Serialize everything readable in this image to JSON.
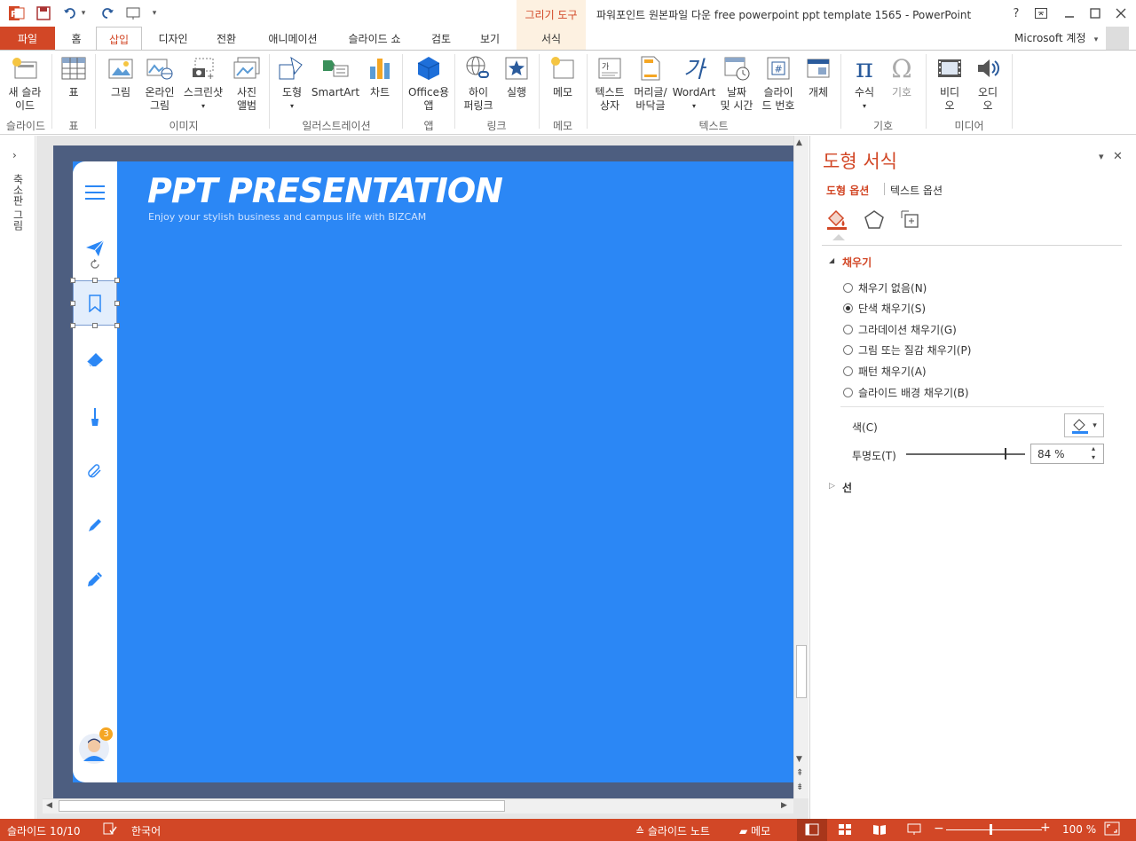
{
  "titlebar": {
    "app_title": "파워포인트 원본파일 다운 free powerpoint ppt template 1565 - PowerPoint",
    "context_group": "그리기 도구",
    "help": "?",
    "undo_dropdown": "▾",
    "qat_more": "▾"
  },
  "tabs": {
    "file": "파일",
    "items": [
      "홈",
      "삽입",
      "디자인",
      "전환",
      "애니메이션",
      "슬라이드 쇼",
      "검토",
      "보기",
      "서식"
    ],
    "active": "삽입",
    "account": "Microsoft 계정"
  },
  "ribbon": {
    "buttons": {
      "new_slide": "새 슬라\n이드",
      "table": "표",
      "picture": "그림",
      "online_picture": "온라인\n그림",
      "screenshot": "스크린샷",
      "photo_album": "사진\n앨범",
      "shapes": "도형",
      "smartart": "SmartArt",
      "chart": "차트",
      "office_apps": "Office용\n앱",
      "hyperlink": "하이\n퍼링크",
      "action": "실행",
      "comment": "메모",
      "textbox": "텍스트\n상자",
      "header_footer": "머리글/\n바닥글",
      "wordart": "WordArt",
      "date_time": "날짜\n및 시간",
      "slide_number": "슬라이\n드 번호",
      "object": "개체",
      "equation": "수식",
      "symbol": "기호",
      "video": "비디\n오",
      "audio": "오디\n오"
    },
    "groups": {
      "slides": "슬라이드",
      "tables": "표",
      "images": "이미지",
      "illustrations": "일러스트레이션",
      "apps": "앱",
      "links": "링크",
      "comments": "메모",
      "text": "텍스트",
      "symbols": "기호",
      "media": "미디어"
    }
  },
  "thumbnails": {
    "expand": "›",
    "label": "축소판 그림"
  },
  "slide": {
    "title": "PPT PRESENTATION",
    "subtitle": "Enjoy your stylish business and campus life with BIZCAM",
    "badge_count": "3",
    "colors": {
      "background": "#4d5e80",
      "panel": "#2b87f5",
      "sidebar": "#ffffff",
      "icon": "#2b87f5"
    }
  },
  "format_pane": {
    "title": "도형 서식",
    "tab_shape": "도형 옵션",
    "tab_text": "텍스트 옵션",
    "fill_header": "채우기",
    "fill_options": [
      {
        "label": "채우기 없음(N)",
        "selected": false
      },
      {
        "label": "단색 채우기(S)",
        "selected": true
      },
      {
        "label": "그라데이션 채우기(G)",
        "selected": false
      },
      {
        "label": "그림 또는 질감 채우기(P)",
        "selected": false
      },
      {
        "label": "패턴 채우기(A)",
        "selected": false
      },
      {
        "label": "슬라이드 배경 채우기(B)",
        "selected": false
      }
    ],
    "color_label": "색(C)",
    "transparency_label": "투명도(T)",
    "transparency_value": "84 %",
    "transparency_percent": 84,
    "line_header": "선",
    "fill_expand": "◢",
    "line_expand": "▷",
    "color_dropdown": "▾",
    "spinner_up": "▴",
    "spinner_down": "▾",
    "pin": "▾",
    "close": "✕"
  },
  "statusbar": {
    "slide_indicator": "슬라이드 10/10",
    "language": "한국어",
    "notes": "슬라이드 노트",
    "comments": "메모",
    "zoom": "100 %",
    "zoom_minus": "−",
    "zoom_plus": "+",
    "zoom_level_percent": 100
  },
  "accent_color": "#d24726"
}
